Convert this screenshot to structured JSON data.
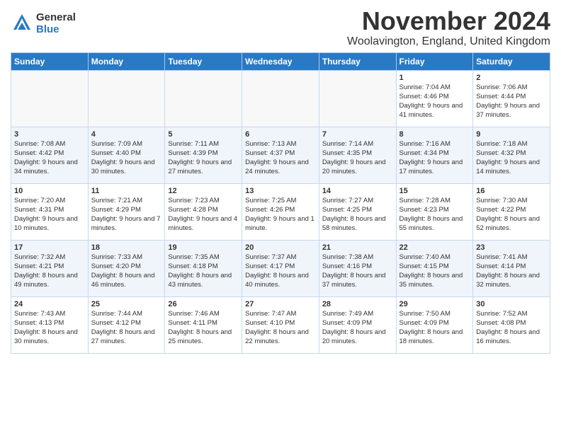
{
  "header": {
    "logo_general": "General",
    "logo_blue": "Blue",
    "month_title": "November 2024",
    "location": "Woolavington, England, United Kingdom"
  },
  "days_of_week": [
    "Sunday",
    "Monday",
    "Tuesday",
    "Wednesday",
    "Thursday",
    "Friday",
    "Saturday"
  ],
  "weeks": [
    [
      {
        "day": null,
        "sunrise": null,
        "sunset": null,
        "daylight": null
      },
      {
        "day": null,
        "sunrise": null,
        "sunset": null,
        "daylight": null
      },
      {
        "day": null,
        "sunrise": null,
        "sunset": null,
        "daylight": null
      },
      {
        "day": null,
        "sunrise": null,
        "sunset": null,
        "daylight": null
      },
      {
        "day": null,
        "sunrise": null,
        "sunset": null,
        "daylight": null
      },
      {
        "day": "1",
        "sunrise": "Sunrise: 7:04 AM",
        "sunset": "Sunset: 4:46 PM",
        "daylight": "Daylight: 9 hours and 41 minutes."
      },
      {
        "day": "2",
        "sunrise": "Sunrise: 7:06 AM",
        "sunset": "Sunset: 4:44 PM",
        "daylight": "Daylight: 9 hours and 37 minutes."
      }
    ],
    [
      {
        "day": "3",
        "sunrise": "Sunrise: 7:08 AM",
        "sunset": "Sunset: 4:42 PM",
        "daylight": "Daylight: 9 hours and 34 minutes."
      },
      {
        "day": "4",
        "sunrise": "Sunrise: 7:09 AM",
        "sunset": "Sunset: 4:40 PM",
        "daylight": "Daylight: 9 hours and 30 minutes."
      },
      {
        "day": "5",
        "sunrise": "Sunrise: 7:11 AM",
        "sunset": "Sunset: 4:39 PM",
        "daylight": "Daylight: 9 hours and 27 minutes."
      },
      {
        "day": "6",
        "sunrise": "Sunrise: 7:13 AM",
        "sunset": "Sunset: 4:37 PM",
        "daylight": "Daylight: 9 hours and 24 minutes."
      },
      {
        "day": "7",
        "sunrise": "Sunrise: 7:14 AM",
        "sunset": "Sunset: 4:35 PM",
        "daylight": "Daylight: 9 hours and 20 minutes."
      },
      {
        "day": "8",
        "sunrise": "Sunrise: 7:16 AM",
        "sunset": "Sunset: 4:34 PM",
        "daylight": "Daylight: 9 hours and 17 minutes."
      },
      {
        "day": "9",
        "sunrise": "Sunrise: 7:18 AM",
        "sunset": "Sunset: 4:32 PM",
        "daylight": "Daylight: 9 hours and 14 minutes."
      }
    ],
    [
      {
        "day": "10",
        "sunrise": "Sunrise: 7:20 AM",
        "sunset": "Sunset: 4:31 PM",
        "daylight": "Daylight: 9 hours and 10 minutes."
      },
      {
        "day": "11",
        "sunrise": "Sunrise: 7:21 AM",
        "sunset": "Sunset: 4:29 PM",
        "daylight": "Daylight: 9 hours and 7 minutes."
      },
      {
        "day": "12",
        "sunrise": "Sunrise: 7:23 AM",
        "sunset": "Sunset: 4:28 PM",
        "daylight": "Daylight: 9 hours and 4 minutes."
      },
      {
        "day": "13",
        "sunrise": "Sunrise: 7:25 AM",
        "sunset": "Sunset: 4:26 PM",
        "daylight": "Daylight: 9 hours and 1 minute."
      },
      {
        "day": "14",
        "sunrise": "Sunrise: 7:27 AM",
        "sunset": "Sunset: 4:25 PM",
        "daylight": "Daylight: 8 hours and 58 minutes."
      },
      {
        "day": "15",
        "sunrise": "Sunrise: 7:28 AM",
        "sunset": "Sunset: 4:23 PM",
        "daylight": "Daylight: 8 hours and 55 minutes."
      },
      {
        "day": "16",
        "sunrise": "Sunrise: 7:30 AM",
        "sunset": "Sunset: 4:22 PM",
        "daylight": "Daylight: 8 hours and 52 minutes."
      }
    ],
    [
      {
        "day": "17",
        "sunrise": "Sunrise: 7:32 AM",
        "sunset": "Sunset: 4:21 PM",
        "daylight": "Daylight: 8 hours and 49 minutes."
      },
      {
        "day": "18",
        "sunrise": "Sunrise: 7:33 AM",
        "sunset": "Sunset: 4:20 PM",
        "daylight": "Daylight: 8 hours and 46 minutes."
      },
      {
        "day": "19",
        "sunrise": "Sunrise: 7:35 AM",
        "sunset": "Sunset: 4:18 PM",
        "daylight": "Daylight: 8 hours and 43 minutes."
      },
      {
        "day": "20",
        "sunrise": "Sunrise: 7:37 AM",
        "sunset": "Sunset: 4:17 PM",
        "daylight": "Daylight: 8 hours and 40 minutes."
      },
      {
        "day": "21",
        "sunrise": "Sunrise: 7:38 AM",
        "sunset": "Sunset: 4:16 PM",
        "daylight": "Daylight: 8 hours and 37 minutes."
      },
      {
        "day": "22",
        "sunrise": "Sunrise: 7:40 AM",
        "sunset": "Sunset: 4:15 PM",
        "daylight": "Daylight: 8 hours and 35 minutes."
      },
      {
        "day": "23",
        "sunrise": "Sunrise: 7:41 AM",
        "sunset": "Sunset: 4:14 PM",
        "daylight": "Daylight: 8 hours and 32 minutes."
      }
    ],
    [
      {
        "day": "24",
        "sunrise": "Sunrise: 7:43 AM",
        "sunset": "Sunset: 4:13 PM",
        "daylight": "Daylight: 8 hours and 30 minutes."
      },
      {
        "day": "25",
        "sunrise": "Sunrise: 7:44 AM",
        "sunset": "Sunset: 4:12 PM",
        "daylight": "Daylight: 8 hours and 27 minutes."
      },
      {
        "day": "26",
        "sunrise": "Sunrise: 7:46 AM",
        "sunset": "Sunset: 4:11 PM",
        "daylight": "Daylight: 8 hours and 25 minutes."
      },
      {
        "day": "27",
        "sunrise": "Sunrise: 7:47 AM",
        "sunset": "Sunset: 4:10 PM",
        "daylight": "Daylight: 8 hours and 22 minutes."
      },
      {
        "day": "28",
        "sunrise": "Sunrise: 7:49 AM",
        "sunset": "Sunset: 4:09 PM",
        "daylight": "Daylight: 8 hours and 20 minutes."
      },
      {
        "day": "29",
        "sunrise": "Sunrise: 7:50 AM",
        "sunset": "Sunset: 4:09 PM",
        "daylight": "Daylight: 8 hours and 18 minutes."
      },
      {
        "day": "30",
        "sunrise": "Sunrise: 7:52 AM",
        "sunset": "Sunset: 4:08 PM",
        "daylight": "Daylight: 8 hours and 16 minutes."
      }
    ]
  ]
}
